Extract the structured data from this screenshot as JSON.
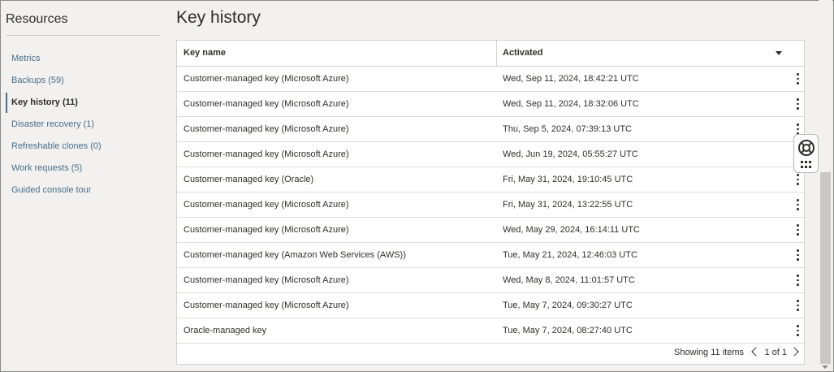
{
  "sidebar": {
    "title": "Resources",
    "items": [
      {
        "label": "Metrics",
        "active": false
      },
      {
        "label": "Backups (59)",
        "active": false
      },
      {
        "label": "Key history (11)",
        "active": true
      },
      {
        "label": "Disaster recovery (1)",
        "active": false
      },
      {
        "label": "Refreshable clones (0)",
        "active": false
      },
      {
        "label": "Work requests (5)",
        "active": false
      },
      {
        "label": "Guided console tour",
        "active": false
      }
    ]
  },
  "page": {
    "title": "Key history"
  },
  "table": {
    "columns": [
      "Key name",
      "Activated"
    ],
    "rows": [
      {
        "key_name": "Customer-managed key (Microsoft Azure)",
        "activated": "Wed, Sep 11, 2024, 18:42:21 UTC"
      },
      {
        "key_name": "Customer-managed key (Microsoft Azure)",
        "activated": "Wed, Sep 11, 2024, 18:32:06 UTC"
      },
      {
        "key_name": "Customer-managed key (Microsoft Azure)",
        "activated": "Thu, Sep 5, 2024, 07:39:13 UTC"
      },
      {
        "key_name": "Customer-managed key (Microsoft Azure)",
        "activated": "Wed, Jun 19, 2024, 05:55:27 UTC"
      },
      {
        "key_name": "Customer-managed key (Oracle)",
        "activated": "Fri, May 31, 2024, 19:10:45 UTC"
      },
      {
        "key_name": "Customer-managed key (Microsoft Azure)",
        "activated": "Fri, May 31, 2024, 13:22:55 UTC"
      },
      {
        "key_name": "Customer-managed key (Microsoft Azure)",
        "activated": "Wed, May 29, 2024, 16:14:11 UTC"
      },
      {
        "key_name": "Customer-managed key (Amazon Web Services (AWS))",
        "activated": "Tue, May 21, 2024, 12:46:03 UTC"
      },
      {
        "key_name": "Customer-managed key (Microsoft Azure)",
        "activated": "Wed, May 8, 2024, 11:01:57 UTC"
      },
      {
        "key_name": "Customer-managed key (Microsoft Azure)",
        "activated": "Tue, May 7, 2024, 09:30:27 UTC"
      },
      {
        "key_name": "Oracle-managed key",
        "activated": "Tue, May 7, 2024, 08:27:40 UTC"
      }
    ],
    "footer": {
      "showing": "Showing 11 items",
      "page": "1 of 1"
    }
  },
  "icons": {
    "row_actions": "kebab-icon",
    "sort": "caret-down-icon",
    "prev": "chevron-left-icon",
    "next": "chevron-right-icon",
    "help": "lifebuoy-icon",
    "apps": "grid-icon"
  },
  "colors": {
    "link": "#4a6d8a",
    "text": "#312d2a",
    "background": "#f2f1ef"
  }
}
